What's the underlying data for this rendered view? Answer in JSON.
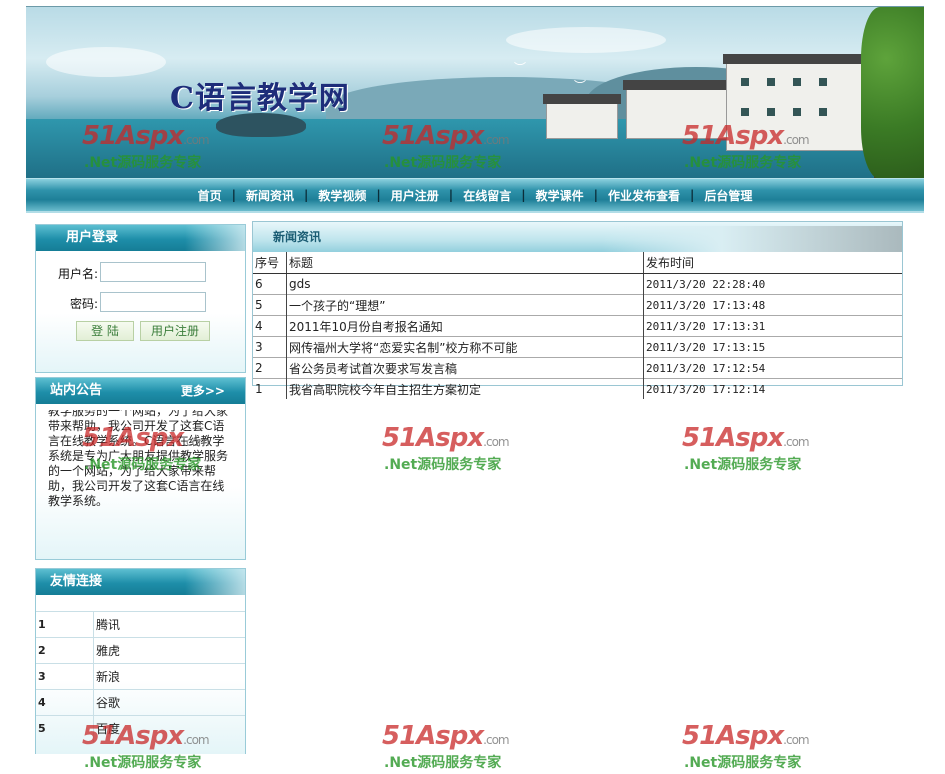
{
  "site": {
    "title": "C语言教学网"
  },
  "nav": {
    "items": [
      "首页",
      "新闻资讯",
      "教学视频",
      "用户注册",
      "在线留言",
      "教学课件",
      "作业发布查看",
      "后台管理"
    ],
    "separator": "|"
  },
  "login": {
    "title": "用户登录",
    "username_label": "用户名:",
    "password_label": "密码:",
    "username_value": "",
    "password_value": "",
    "login_button": "登 陆",
    "register_button": "用户注册"
  },
  "notice": {
    "title": "站内公告",
    "more": "更多>>",
    "text": "教学服务的一个网站，为了给大家带来帮助，我公司开发了这套C语言在线教学系统。C语言在线教学系统是专为广大朋友提供教学服务的一个网站，为了给大家带来帮助，我公司开发了这套C语言在线教学系统。"
  },
  "links": {
    "title": "友情连接",
    "items": [
      {
        "index": "1",
        "name": "腾讯"
      },
      {
        "index": "2",
        "name": "雅虎"
      },
      {
        "index": "3",
        "name": "新浪"
      },
      {
        "index": "4",
        "name": "谷歌"
      },
      {
        "index": "5",
        "name": "百度"
      }
    ]
  },
  "news": {
    "title": "新闻资讯",
    "columns": [
      "序号",
      "标题",
      "发布时间"
    ],
    "rows": [
      {
        "id": "6",
        "title": "gds",
        "time": "2011/3/20 22:28:40"
      },
      {
        "id": "5",
        "title": "一个孩子的“理想”",
        "time": "2011/3/20 17:13:48"
      },
      {
        "id": "4",
        "title": "2011年10月份自考报名通知",
        "time": "2011/3/20 17:13:31"
      },
      {
        "id": "3",
        "title": "网传福州大学将“恋爱实名制”校方称不可能",
        "time": "2011/3/20 17:13:15"
      },
      {
        "id": "2",
        "title": "省公务员考试首次要求写发言稿",
        "time": "2011/3/20 17:12:54"
      },
      {
        "id": "1",
        "title": "我省高职院校今年自主招生方案初定",
        "time": "2011/3/20 17:12:14"
      }
    ]
  },
  "watermark": {
    "brand": "51Aspx",
    "domain": ".com",
    "slogan": ".Net源码服务专家"
  },
  "colors": {
    "nav_bg": "#1e7f98",
    "panel_head": "#1e8ea9",
    "title_text": "#1e2d7a",
    "watermark_red": "#c82828",
    "watermark_green": "#289628"
  }
}
